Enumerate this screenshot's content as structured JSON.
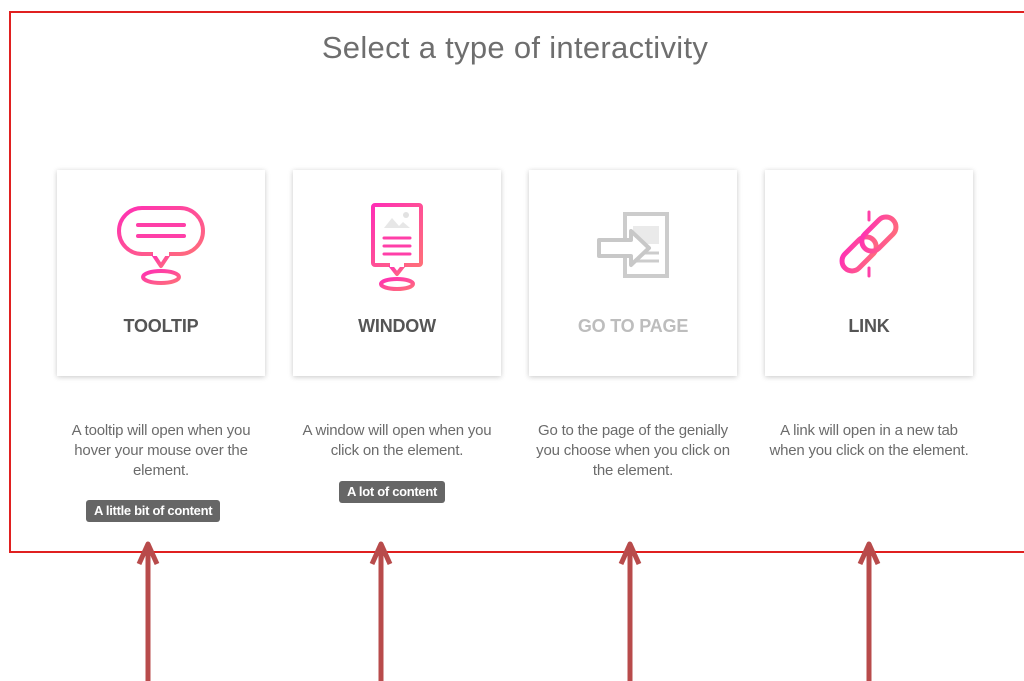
{
  "heading": "Select a type of interactivity",
  "options": [
    {
      "label": "TOOLTIP",
      "icon": "speech-bubble-icon",
      "description": "A tooltip will open when you hover your mouse over the element.",
      "badge": "A little bit of content",
      "enabled": true
    },
    {
      "label": "WINDOW",
      "icon": "window-image-icon",
      "description": "A window will open when you click on the element.",
      "badge": "A lot of content",
      "enabled": true
    },
    {
      "label": "GO TO PAGE",
      "icon": "go-to-page-icon",
      "description": "Go to the page of the genially you choose when you click on the element.",
      "enabled": false
    },
    {
      "label": "LINK",
      "icon": "link-chain-icon",
      "description": "A link will open in a new tab when you click on the element.",
      "enabled": true
    }
  ],
  "colors": {
    "accent_gradient_start": "#ff3fb0",
    "accent_gradient_end": "#ff7a66",
    "frame_border": "#e02020",
    "annotation_arrow": "#b84b4b",
    "badge_background": "#666666",
    "disabled_icon": "#cccccc"
  }
}
